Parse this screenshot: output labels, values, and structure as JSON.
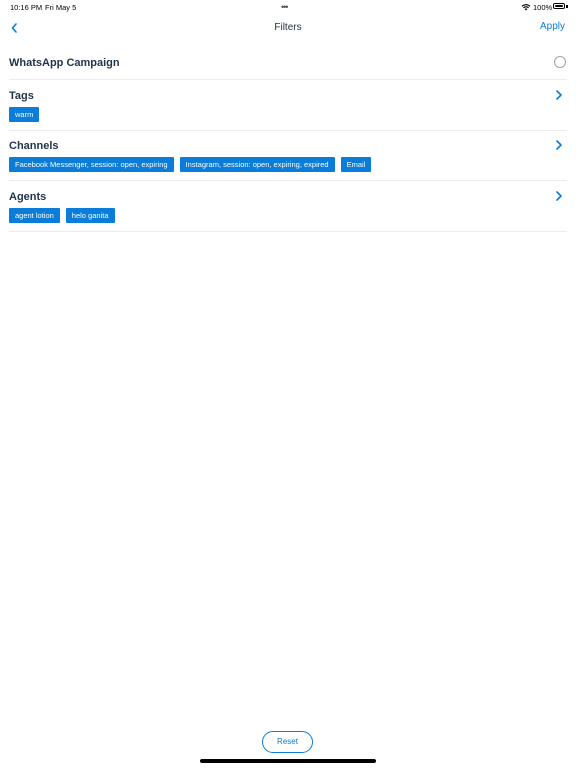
{
  "status_bar": {
    "time": "10:16 PM",
    "date": "Fri May 5",
    "dots": "•••",
    "battery_percent": "100%"
  },
  "nav": {
    "title": "Filters",
    "apply_label": "Apply",
    "back_icon": "chevron-left-icon"
  },
  "campaign": {
    "label": "WhatsApp Campaign",
    "selected": false
  },
  "tags": {
    "title": "Tags",
    "chips": [
      "warm"
    ]
  },
  "channels": {
    "title": "Channels",
    "chips": [
      "Facebook Messenger, session: open, expiring",
      "Instagram, session: open, expiring, expired",
      "Email"
    ]
  },
  "agents": {
    "title": "Agents",
    "chips": [
      "agent lotion",
      "helo ganita"
    ]
  },
  "footer": {
    "reset_label": "Reset"
  },
  "colors": {
    "accent": "#0a7cd9",
    "title_text": "#24344d",
    "divider": "#e9ecef"
  }
}
